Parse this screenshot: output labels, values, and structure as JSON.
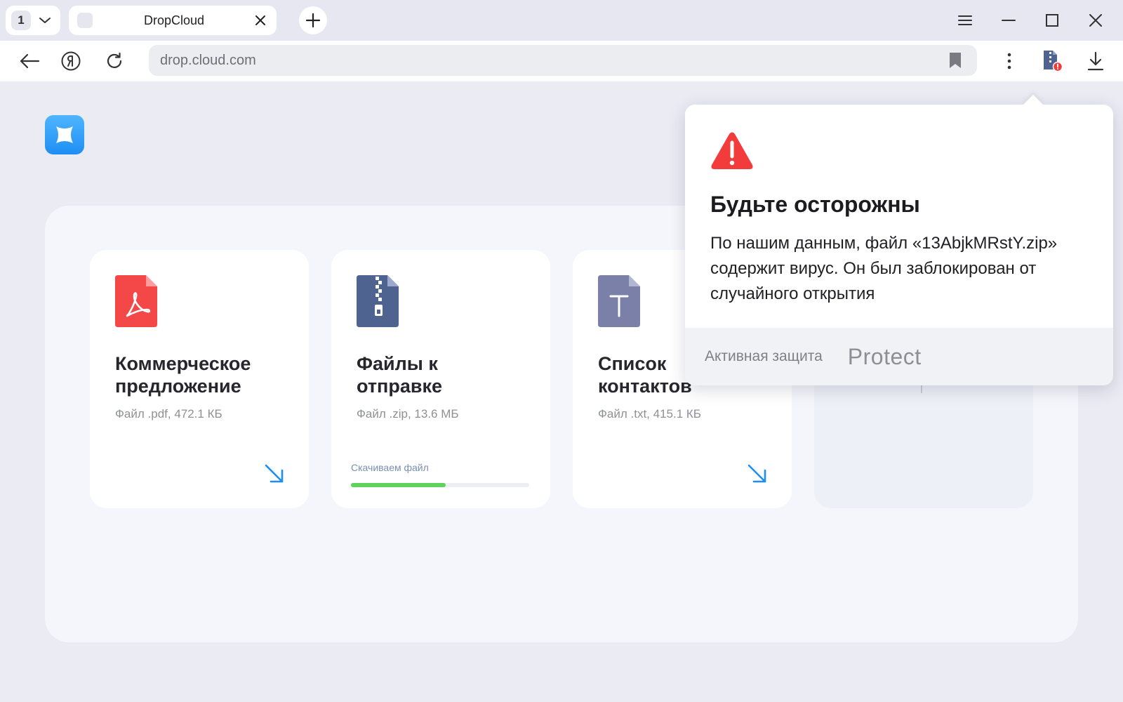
{
  "tabstrip": {
    "tab_count": "1",
    "active_tab_title": "DropCloud"
  },
  "toolbar": {
    "url": "drop.cloud.com"
  },
  "files": [
    {
      "title": "Коммерческое предложение",
      "meta": "Файл .pdf, 472.1 КБ",
      "icon": "pdf-file-icon",
      "color": "#f44747"
    },
    {
      "title": "Файлы к отправке",
      "meta": "Файл .zip, 13.6 МБ",
      "icon": "zip-file-icon",
      "color": "#4f6391",
      "progress_label": "Скачиваем файл",
      "progress": 0.53
    },
    {
      "title": "Список контактов",
      "meta": "Файл .txt, 415.1 КБ",
      "icon": "txt-file-icon",
      "color": "#7a80a8"
    }
  ],
  "popup": {
    "title": "Будьте осторожны",
    "body": "По нашим данным, файл «13AbjkMRstY.zip» содержит вирус. Он был заблокирован от случайного открытия",
    "footer_label": "Активная защита",
    "brand": "Protect",
    "warning_color": "#f23b3b"
  },
  "colors": {
    "accent": "#1e8ef4",
    "progress": "#5ed35b"
  }
}
